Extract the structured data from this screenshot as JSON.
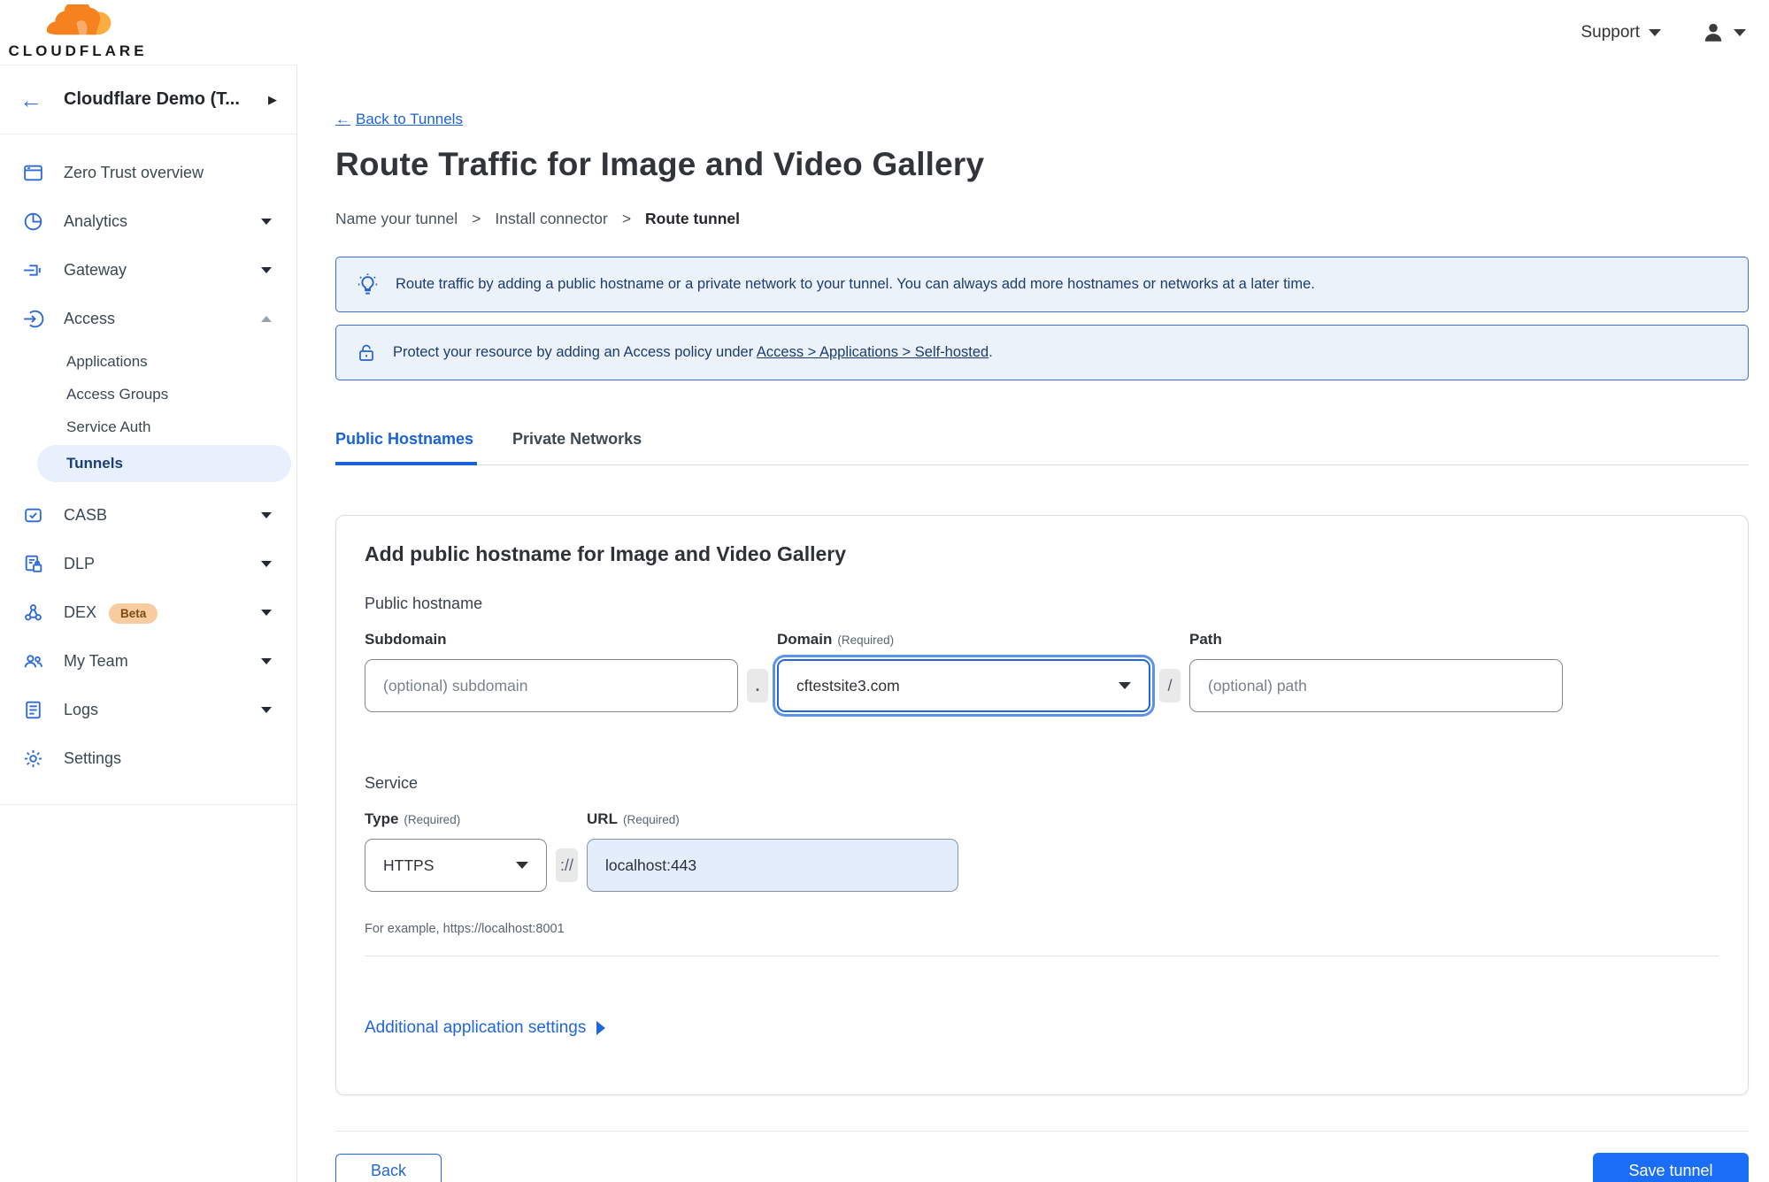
{
  "topbar": {
    "logo_word": "CLOUDFLARE",
    "support_label": "Support"
  },
  "sidebar": {
    "account_name": "Cloudflare Demo (T...",
    "items": [
      {
        "label": "Zero Trust overview",
        "icon": "window-icon",
        "chevron": "none"
      },
      {
        "label": "Analytics",
        "icon": "pie-chart-icon",
        "chevron": "down"
      },
      {
        "label": "Gateway",
        "icon": "gateway-icon",
        "chevron": "down"
      },
      {
        "label": "Access",
        "icon": "access-icon",
        "chevron": "up"
      },
      {
        "label": "CASB",
        "icon": "casb-icon",
        "chevron": "down"
      },
      {
        "label": "DLP",
        "icon": "dlp-icon",
        "chevron": "down"
      },
      {
        "label": "DEX",
        "icon": "dex-icon",
        "chevron": "down",
        "badge": "Beta"
      },
      {
        "label": "My Team",
        "icon": "team-icon",
        "chevron": "down"
      },
      {
        "label": "Logs",
        "icon": "logs-icon",
        "chevron": "down"
      },
      {
        "label": "Settings",
        "icon": "gear-icon",
        "chevron": "none"
      }
    ],
    "access_subitems": [
      {
        "label": "Applications",
        "active": false
      },
      {
        "label": "Access Groups",
        "active": false
      },
      {
        "label": "Service Auth",
        "active": false
      },
      {
        "label": "Tunnels",
        "active": true
      }
    ]
  },
  "page": {
    "back_arrow": "←",
    "back_link": "Back to Tunnels",
    "title": "Route Traffic for Image and Video Gallery",
    "steps": {
      "s0": "Name your tunnel",
      "s1": "Install connector",
      "s2": "Route tunnel",
      "separator": ">"
    },
    "banners": {
      "tip": "Route traffic by adding a public hostname or a private network to your tunnel. You can always add more hostnames or networks at a later time.",
      "protect_before": "Protect your resource by adding an Access policy under ",
      "protect_link": "Access > Applications > Self-hosted",
      "protect_after": "."
    },
    "tabs": {
      "t0": "Public Hostnames",
      "t1": "Private Networks"
    },
    "card": {
      "heading": "Add public hostname for Image and Video Gallery",
      "public_hostname_label": "Public hostname",
      "subdomain": {
        "label": "Subdomain",
        "placeholder": "(optional) subdomain"
      },
      "domain": {
        "label": "Domain",
        "required": "(Required)",
        "value": "cftestsite3.com"
      },
      "path": {
        "label": "Path",
        "placeholder": "(optional) path"
      },
      "dot_separator": ".",
      "slash_separator": "/",
      "service_label": "Service",
      "type": {
        "label": "Type",
        "required": "(Required)",
        "value": "HTTPS"
      },
      "scheme_separator": "://",
      "url": {
        "label": "URL",
        "required": "(Required)",
        "value": "localhost:443"
      },
      "hint": "For example, https://localhost:8001",
      "additional_settings": "Additional application settings"
    },
    "footer": {
      "back": "Back",
      "save": "Save tunnel"
    }
  },
  "colors": {
    "accent_blue": "#1a62d8",
    "save_button_blue": "#1a6ef5",
    "banner_bg": "#ebf2fa",
    "banner_border": "#3d70c8",
    "banner_text": "#1d3c6e",
    "cloudflare_orange": "#f6821f",
    "cloudflare_orange_light": "#fbad41",
    "active_nav_bg": "#e7f0fc",
    "url_input_bg": "#e4edfb",
    "beta_badge_bg": "#f8cc9e"
  }
}
